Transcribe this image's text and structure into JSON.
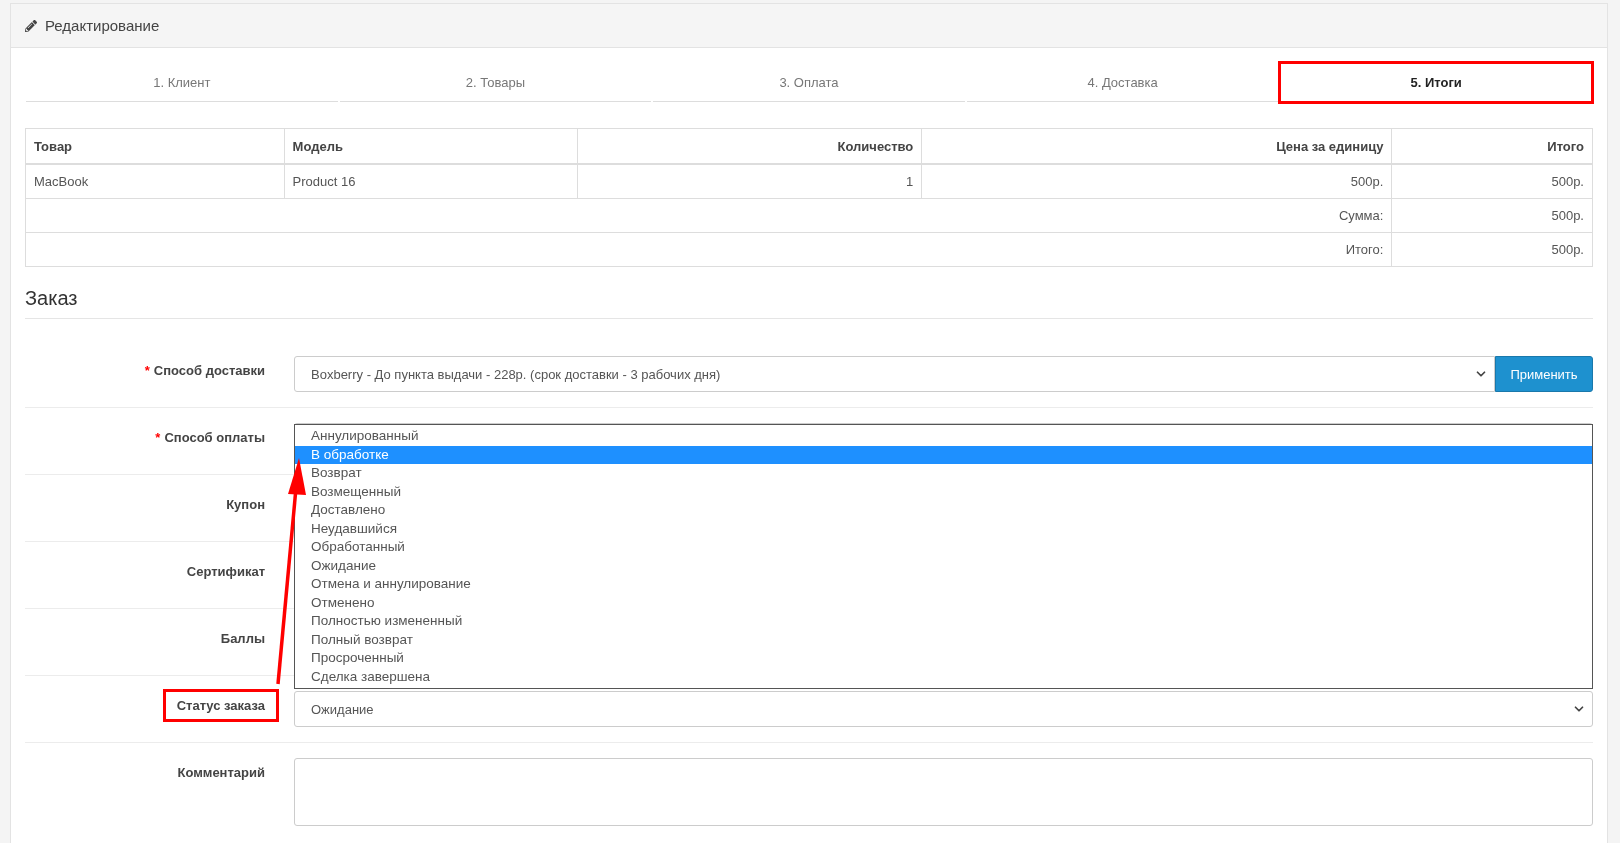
{
  "panel": {
    "title": "Редактирование"
  },
  "tabs": [
    {
      "label": "1. Клиент",
      "selected": false,
      "highlighted": false
    },
    {
      "label": "2. Товары",
      "selected": false,
      "highlighted": false
    },
    {
      "label": "3. Оплата",
      "selected": false,
      "highlighted": false
    },
    {
      "label": "4. Доставка",
      "selected": false,
      "highlighted": false
    },
    {
      "label": "5. Итоги",
      "selected": true,
      "highlighted": true
    }
  ],
  "cart_table": {
    "columns": [
      {
        "label": "Товар"
      },
      {
        "label": "Модель"
      },
      {
        "label": "Количество"
      },
      {
        "label": "Цена за единицу"
      },
      {
        "label": "Итого"
      }
    ],
    "rows": [
      {
        "cells": [
          "MacBook",
          "Product 16",
          "1",
          "500р.",
          "500р."
        ]
      }
    ],
    "totals": [
      {
        "label": "Сумма:",
        "value": "500р."
      },
      {
        "label": "Итого:",
        "value": "500р."
      }
    ]
  },
  "order": {
    "heading": "Заказ",
    "required_mark": "*",
    "fields": [
      {
        "kind": "select-button",
        "label": "Способ доставки",
        "required": true,
        "highlighted": false,
        "value": "Boxberry - До пункта выдачи - 228р. (срок доставки - 3 рабочих дня)",
        "button": "Применить"
      },
      {
        "kind": "select",
        "label": "Способ оплаты",
        "required": true,
        "highlighted": false
      },
      {
        "kind": "input",
        "label": "Купон",
        "required": false,
        "highlighted": false
      },
      {
        "kind": "input",
        "label": "Сертификат",
        "required": false,
        "highlighted": false
      },
      {
        "kind": "input",
        "label": "Баллы",
        "required": false,
        "highlighted": false
      },
      {
        "kind": "select",
        "label": "Статус заказа",
        "required": false,
        "highlighted": true,
        "value": "Ожидание"
      },
      {
        "kind": "textarea",
        "label": "Комментарий",
        "required": false,
        "highlighted": false
      }
    ],
    "status_dropdown": {
      "options": [
        {
          "label": "Аннулированный",
          "selected": false
        },
        {
          "label": "В обработке",
          "selected": true
        },
        {
          "label": "Возврат",
          "selected": false
        },
        {
          "label": "Возмещенный",
          "selected": false
        },
        {
          "label": "Доставлено",
          "selected": false
        },
        {
          "label": "Неудавшийся",
          "selected": false
        },
        {
          "label": "Обработанный",
          "selected": false
        },
        {
          "label": "Ожидание",
          "selected": false
        },
        {
          "label": "Отмена и аннулирование",
          "selected": false
        },
        {
          "label": "Отменено",
          "selected": false
        },
        {
          "label": "Полностью измененный",
          "selected": false
        },
        {
          "label": "Полный возврат",
          "selected": false
        },
        {
          "label": "Просроченный",
          "selected": false
        },
        {
          "label": "Сделка завершена",
          "selected": false
        }
      ]
    }
  }
}
